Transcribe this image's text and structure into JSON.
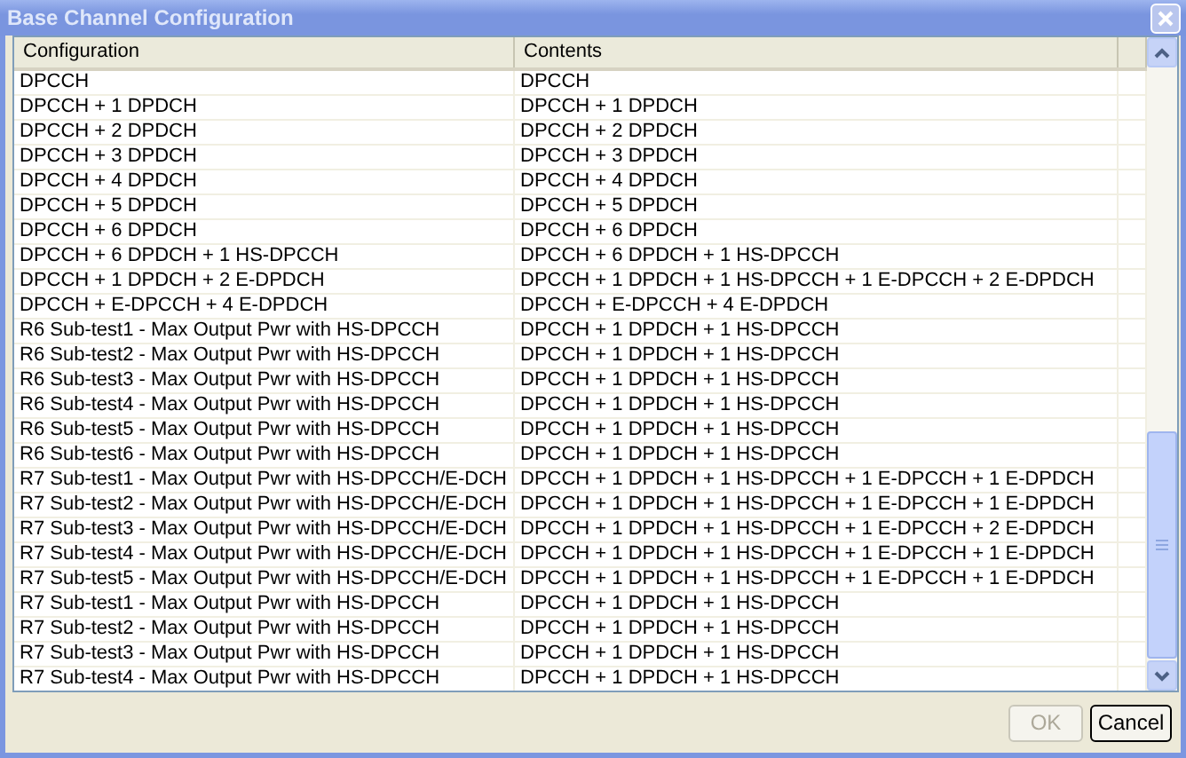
{
  "window": {
    "title": "Base Channel Configuration"
  },
  "table": {
    "columns": [
      "Configuration",
      "Contents"
    ],
    "rows": [
      [
        "DPCCH",
        "DPCCH"
      ],
      [
        "DPCCH + 1 DPDCH",
        "DPCCH + 1 DPDCH"
      ],
      [
        "DPCCH + 2 DPDCH",
        "DPCCH + 2 DPDCH"
      ],
      [
        "DPCCH + 3 DPDCH",
        "DPCCH + 3 DPDCH"
      ],
      [
        "DPCCH + 4 DPDCH",
        "DPCCH + 4 DPDCH"
      ],
      [
        "DPCCH + 5 DPDCH",
        "DPCCH + 5 DPDCH"
      ],
      [
        "DPCCH + 6 DPDCH",
        "DPCCH + 6 DPDCH"
      ],
      [
        "DPCCH + 6 DPDCH + 1 HS-DPCCH",
        "DPCCH + 6 DPDCH + 1 HS-DPCCH"
      ],
      [
        "DPCCH + 1 DPDCH + 2 E-DPDCH",
        "DPCCH + 1 DPDCH + 1 HS-DPCCH + 1 E-DPCCH + 2 E-DPDCH"
      ],
      [
        "DPCCH + E-DPCCH + 4 E-DPDCH",
        "DPCCH + E-DPCCH + 4 E-DPDCH"
      ],
      [
        "R6 Sub-test1 - Max Output Pwr with HS-DPCCH",
        "DPCCH + 1 DPDCH + 1 HS-DPCCH"
      ],
      [
        "R6 Sub-test2 - Max Output Pwr with HS-DPCCH",
        "DPCCH + 1 DPDCH + 1 HS-DPCCH"
      ],
      [
        "R6 Sub-test3 - Max Output Pwr with HS-DPCCH",
        "DPCCH + 1 DPDCH + 1 HS-DPCCH"
      ],
      [
        "R6 Sub-test4 - Max Output Pwr with HS-DPCCH",
        "DPCCH + 1 DPDCH + 1 HS-DPCCH"
      ],
      [
        "R6 Sub-test5 - Max Output Pwr with HS-DPCCH",
        "DPCCH + 1 DPDCH + 1 HS-DPCCH"
      ],
      [
        "R6 Sub-test6 - Max Output Pwr with HS-DPCCH",
        "DPCCH + 1 DPDCH + 1 HS-DPCCH"
      ],
      [
        "R7 Sub-test1 - Max Output Pwr with HS-DPCCH/E-DCH",
        "DPCCH + 1 DPDCH + 1 HS-DPCCH + 1 E-DPCCH + 1 E-DPDCH"
      ],
      [
        "R7 Sub-test2 - Max Output Pwr with HS-DPCCH/E-DCH",
        "DPCCH + 1 DPDCH + 1 HS-DPCCH + 1 E-DPCCH + 1 E-DPDCH"
      ],
      [
        "R7 Sub-test3 - Max Output Pwr with HS-DPCCH/E-DCH",
        "DPCCH + 1 DPDCH + 1 HS-DPCCH + 1 E-DPCCH + 2 E-DPDCH"
      ],
      [
        "R7 Sub-test4 - Max Output Pwr with HS-DPCCH/E-DCH",
        "DPCCH + 1 DPDCH + 1 HS-DPCCH + 1 E-DPCCH + 1 E-DPDCH"
      ],
      [
        "R7 Sub-test5 - Max Output Pwr with HS-DPCCH/E-DCH",
        "DPCCH + 1 DPDCH + 1 HS-DPCCH + 1 E-DPCCH + 1 E-DPDCH"
      ],
      [
        "R7 Sub-test1 - Max Output Pwr with HS-DPCCH",
        "DPCCH + 1 DPDCH + 1 HS-DPCCH"
      ],
      [
        "R7 Sub-test2 - Max Output Pwr with HS-DPCCH",
        "DPCCH + 1 DPDCH + 1 HS-DPCCH"
      ],
      [
        "R7 Sub-test3 - Max Output Pwr with HS-DPCCH",
        "DPCCH + 1 DPDCH + 1 HS-DPCCH"
      ],
      [
        "R7 Sub-test4 - Max Output Pwr with HS-DPCCH",
        "DPCCH + 1 DPDCH + 1 HS-DPCCH"
      ]
    ]
  },
  "buttons": [
    {
      "label": "OK",
      "disabled": true
    },
    {
      "label": "Cancel",
      "disabled": false
    }
  ]
}
